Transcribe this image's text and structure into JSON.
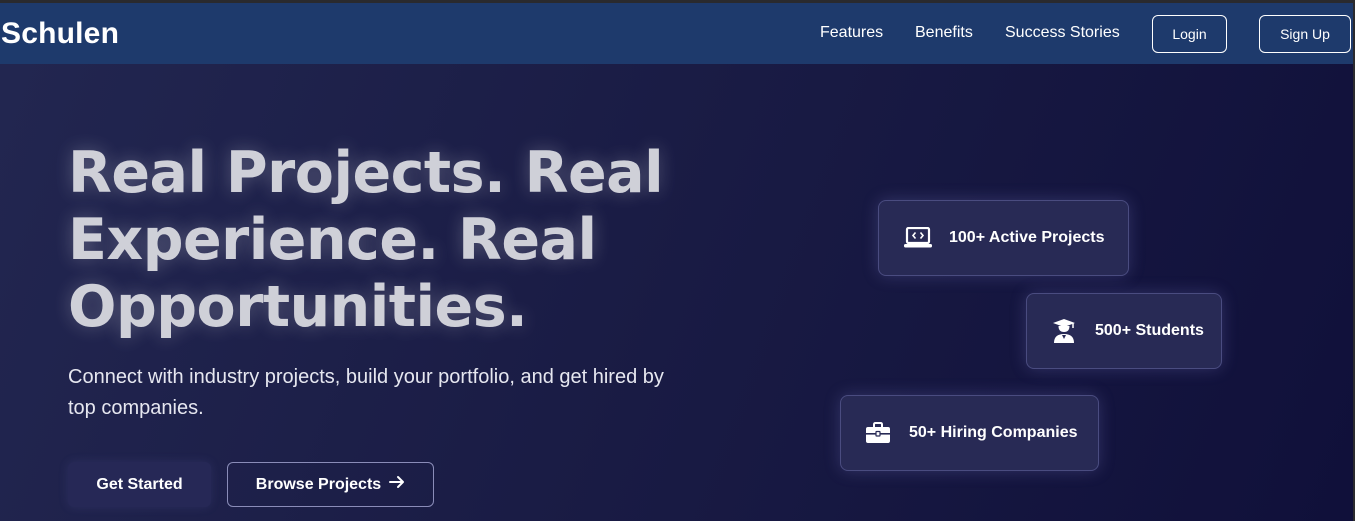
{
  "brand": {
    "name": "Schulen"
  },
  "nav": {
    "links": [
      "Features",
      "Benefits",
      "Success Stories"
    ],
    "login_label": "Login",
    "signup_label": "Sign Up"
  },
  "hero": {
    "headline": "Real Projects. Real Experience. Real Opportunities.",
    "subtext": "Connect with industry projects, build your portfolio, and get hired by top companies.",
    "primary_cta": "Get Started",
    "secondary_cta": "Browse Projects",
    "secondary_cta_icon": "arrow-right-icon"
  },
  "stats": [
    {
      "label": "100+ Active Projects",
      "icon": "laptop-code-icon"
    },
    {
      "label": "500+ Students",
      "icon": "graduate-icon"
    },
    {
      "label": "50+ Hiring Companies",
      "icon": "briefcase-icon"
    }
  ],
  "colors": {
    "navbar": "#1e3a6c",
    "hero_bg": "#1a1c45",
    "card_bg": "#282a55",
    "headline": "#cfd0d8"
  }
}
